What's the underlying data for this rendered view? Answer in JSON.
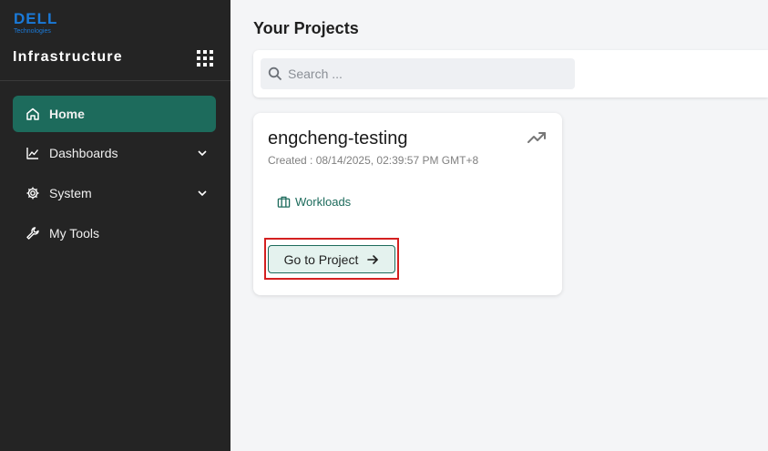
{
  "brand": {
    "logo_text": "DELL",
    "logo_subtext": "Technologies",
    "app_title": "Infrastructure"
  },
  "sidebar": {
    "items": [
      {
        "label": "Home",
        "icon": "home-icon",
        "active": true
      },
      {
        "label": "Dashboards",
        "icon": "chart-line-icon",
        "expandable": true
      },
      {
        "label": "System",
        "icon": "gear-icon",
        "expandable": true
      },
      {
        "label": "My Tools",
        "icon": "wrench-icon"
      }
    ]
  },
  "main": {
    "title": "Your Projects",
    "search": {
      "placeholder": "Search ...",
      "value": ""
    },
    "projects": [
      {
        "name": "engcheng-testing",
        "created": "Created : 08/14/2025, 02:39:57 PM GMT+8",
        "link_label": "Workloads",
        "button_label": "Go to Project"
      }
    ]
  },
  "colors": {
    "sidebar_bg": "#242424",
    "accent": "#1d6b5c",
    "brand_blue": "#1a7ad9",
    "highlight_red": "#d42020"
  }
}
